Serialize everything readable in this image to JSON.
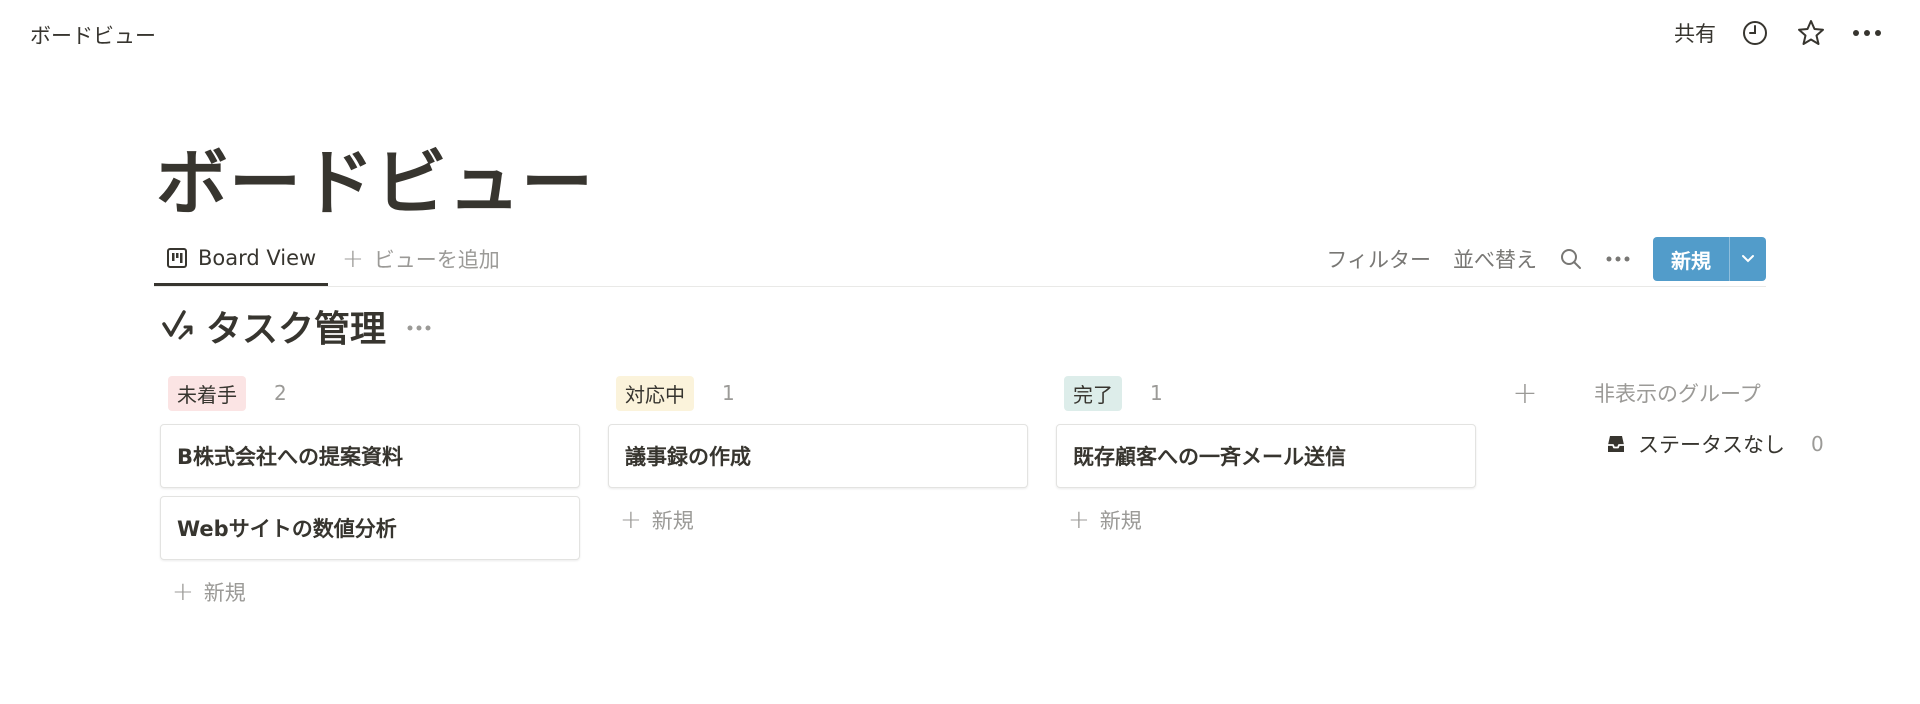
{
  "topbar": {
    "breadcrumb": "ボードビュー",
    "share_label": "共有",
    "icons": [
      "clock-icon",
      "star-icon",
      "more-icon"
    ]
  },
  "page": {
    "title": "ボードビュー"
  },
  "viewbar": {
    "active_tab": "Board View",
    "add_view": "ビューを追加",
    "filter": "フィルター",
    "sort": "並べ替え",
    "new_label": "新規"
  },
  "database": {
    "title": "タスク管理"
  },
  "columns": [
    {
      "status": "未着手",
      "count": "2",
      "tag_bg": "#fbe4e4",
      "tag_fg": "#37352f",
      "cards": [
        "B株式会社への提案資料",
        "Webサイトの数値分析"
      ],
      "new_label": "新規"
    },
    {
      "status": "対応中",
      "count": "1",
      "tag_bg": "#fbf3db",
      "tag_fg": "#37352f",
      "cards": [
        "議事録の作成"
      ],
      "new_label": "新規"
    },
    {
      "status": "完了",
      "count": "1",
      "tag_bg": "#ddedea",
      "tag_fg": "#37352f",
      "cards": [
        "既存顧客への一斉メール送信"
      ],
      "new_label": "新規"
    }
  ],
  "hidden_groups": {
    "label": "非表示のグループ",
    "items": [
      {
        "label": "ステータスなし",
        "count": "0"
      }
    ]
  },
  "colors": {
    "accent": "#529cca",
    "text": "#37352f",
    "muted": "#9b9a97"
  }
}
